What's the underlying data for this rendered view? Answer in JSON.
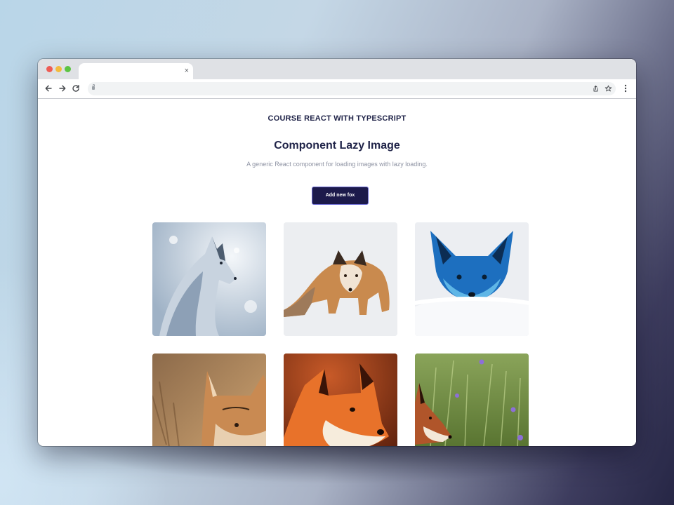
{
  "page": {
    "eyebrow": "COURSE REACT WITH TYPESCRIPT",
    "title": "Component Lazy Image",
    "subtitle": "A generic React component for loading images with lazy loading.",
    "add_button_label": "Add new fox"
  },
  "browser": {
    "tab_close": "×",
    "icons": {
      "back": "arrow-left-icon",
      "forward": "arrow-right-icon",
      "reload": "reload-icon",
      "share": "share-icon",
      "star": "star-icon",
      "menu": "kebab-menu-icon"
    }
  },
  "images": [
    {
      "name": "fox-image-1",
      "subject": "grey fox in snow"
    },
    {
      "name": "fox-image-2",
      "subject": "red fox walking in snow"
    },
    {
      "name": "fox-image-3",
      "subject": "blue-tinted fox in snow"
    },
    {
      "name": "fox-image-4",
      "subject": "red fox in dry grass"
    },
    {
      "name": "fox-image-5",
      "subject": "painted red fox portrait"
    },
    {
      "name": "fox-image-6",
      "subject": "fox in green meadow"
    }
  ],
  "colors": {
    "heading": "#1f2348",
    "subtitle": "#8e93a3",
    "button_bg": "#1c1a4b",
    "button_border": "#6f6fd6"
  }
}
